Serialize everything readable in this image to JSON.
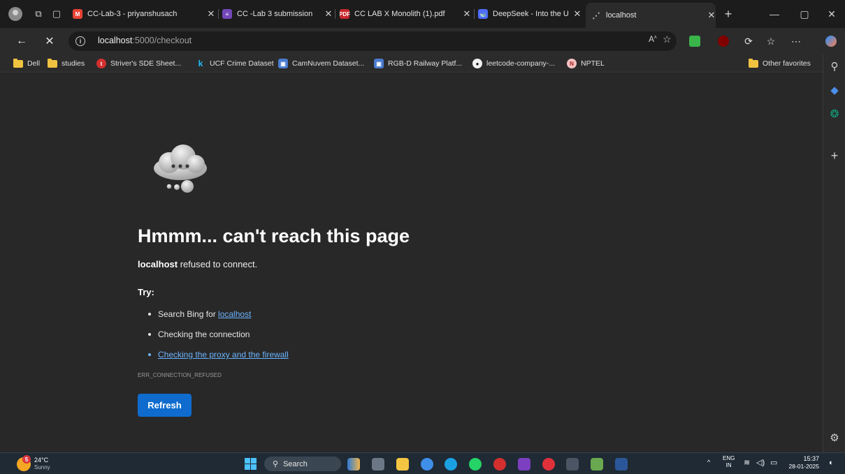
{
  "tabs": [
    {
      "title": "CC-Lab-3 - priyanshusach",
      "favicon": "gmail-icon"
    },
    {
      "title": "CC -Lab 3 submission",
      "favicon": "forms-icon"
    },
    {
      "title": "CC LAB X Monolith (1).pdf",
      "favicon": "pdf-icon"
    },
    {
      "title": "DeepSeek - Into the Unkn",
      "favicon": "deepseek-icon"
    },
    {
      "title": "localhost",
      "favicon": "loading-icon",
      "active": true
    }
  ],
  "address": {
    "host": "localhost",
    "path": ":5000/checkout"
  },
  "bookmarks": [
    {
      "label": "Dell",
      "icon": "folder-icon"
    },
    {
      "label": "studies",
      "icon": "folder-icon"
    },
    {
      "label": "Striver's SDE Sheet...",
      "icon": "tuf-icon"
    },
    {
      "label": "UCF Crime Dataset",
      "icon": "kaggle-icon"
    },
    {
      "label": "CamNuvem Dataset...",
      "icon": "site-icon"
    },
    {
      "label": "RGB-D Railway Platf...",
      "icon": "site-icon"
    },
    {
      "label": "leetcode-company-...",
      "icon": "github-icon"
    },
    {
      "label": "NPTEL",
      "icon": "nptel-icon"
    },
    {
      "label": "Other favorites",
      "icon": "folder-icon"
    }
  ],
  "error": {
    "title": "Hmmm... can't reach this page",
    "host": "localhost",
    "message": " refused to connect.",
    "try_label": "Try:",
    "suggestion_1_prefix": "Search Bing for ",
    "suggestion_1_link": "localhost",
    "suggestion_2": "Checking the connection",
    "suggestion_3_link": "Checking the proxy and the firewall",
    "code": "ERR_CONNECTION_REFUSED",
    "refresh_label": "Refresh"
  },
  "taskbar": {
    "weather_temp": "24°C",
    "weather_cond": "Sunny",
    "weather_badge": "5",
    "search_label": "Search",
    "lang_1": "ENG",
    "lang_2": "IN",
    "time": "15:37",
    "date": "28-01-2025"
  },
  "colors": {
    "accent": "#0f6cce",
    "link": "#6cb4ff",
    "background": "#282828"
  }
}
